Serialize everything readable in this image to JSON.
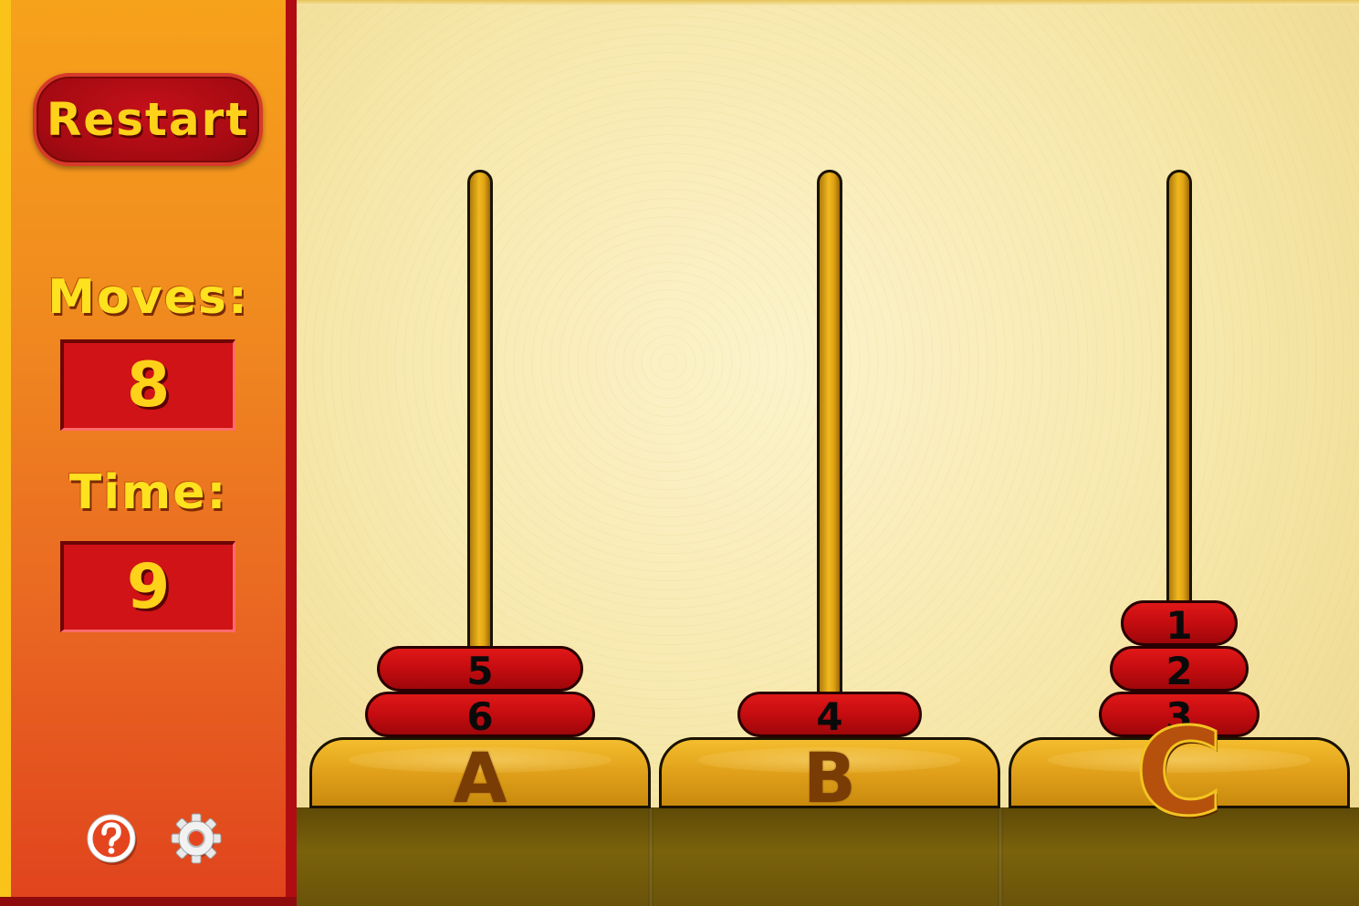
{
  "sidebar": {
    "restart_label": "Restart",
    "moves_label": "Moves:",
    "moves_value": "8",
    "time_label": "Time:",
    "time_value": "9",
    "help_icon": "help-icon",
    "settings_icon": "gear-icon"
  },
  "board": {
    "pegs": [
      {
        "label": "A",
        "disks": [
          "5",
          "6"
        ]
      },
      {
        "label": "B",
        "disks": [
          "4"
        ]
      },
      {
        "label": "C",
        "disks": [
          "1",
          "2",
          "3"
        ]
      }
    ]
  },
  "colors": {
    "disk": "#c40c10",
    "peg": "#e2a414",
    "accent_text": "#ffd21a"
  }
}
